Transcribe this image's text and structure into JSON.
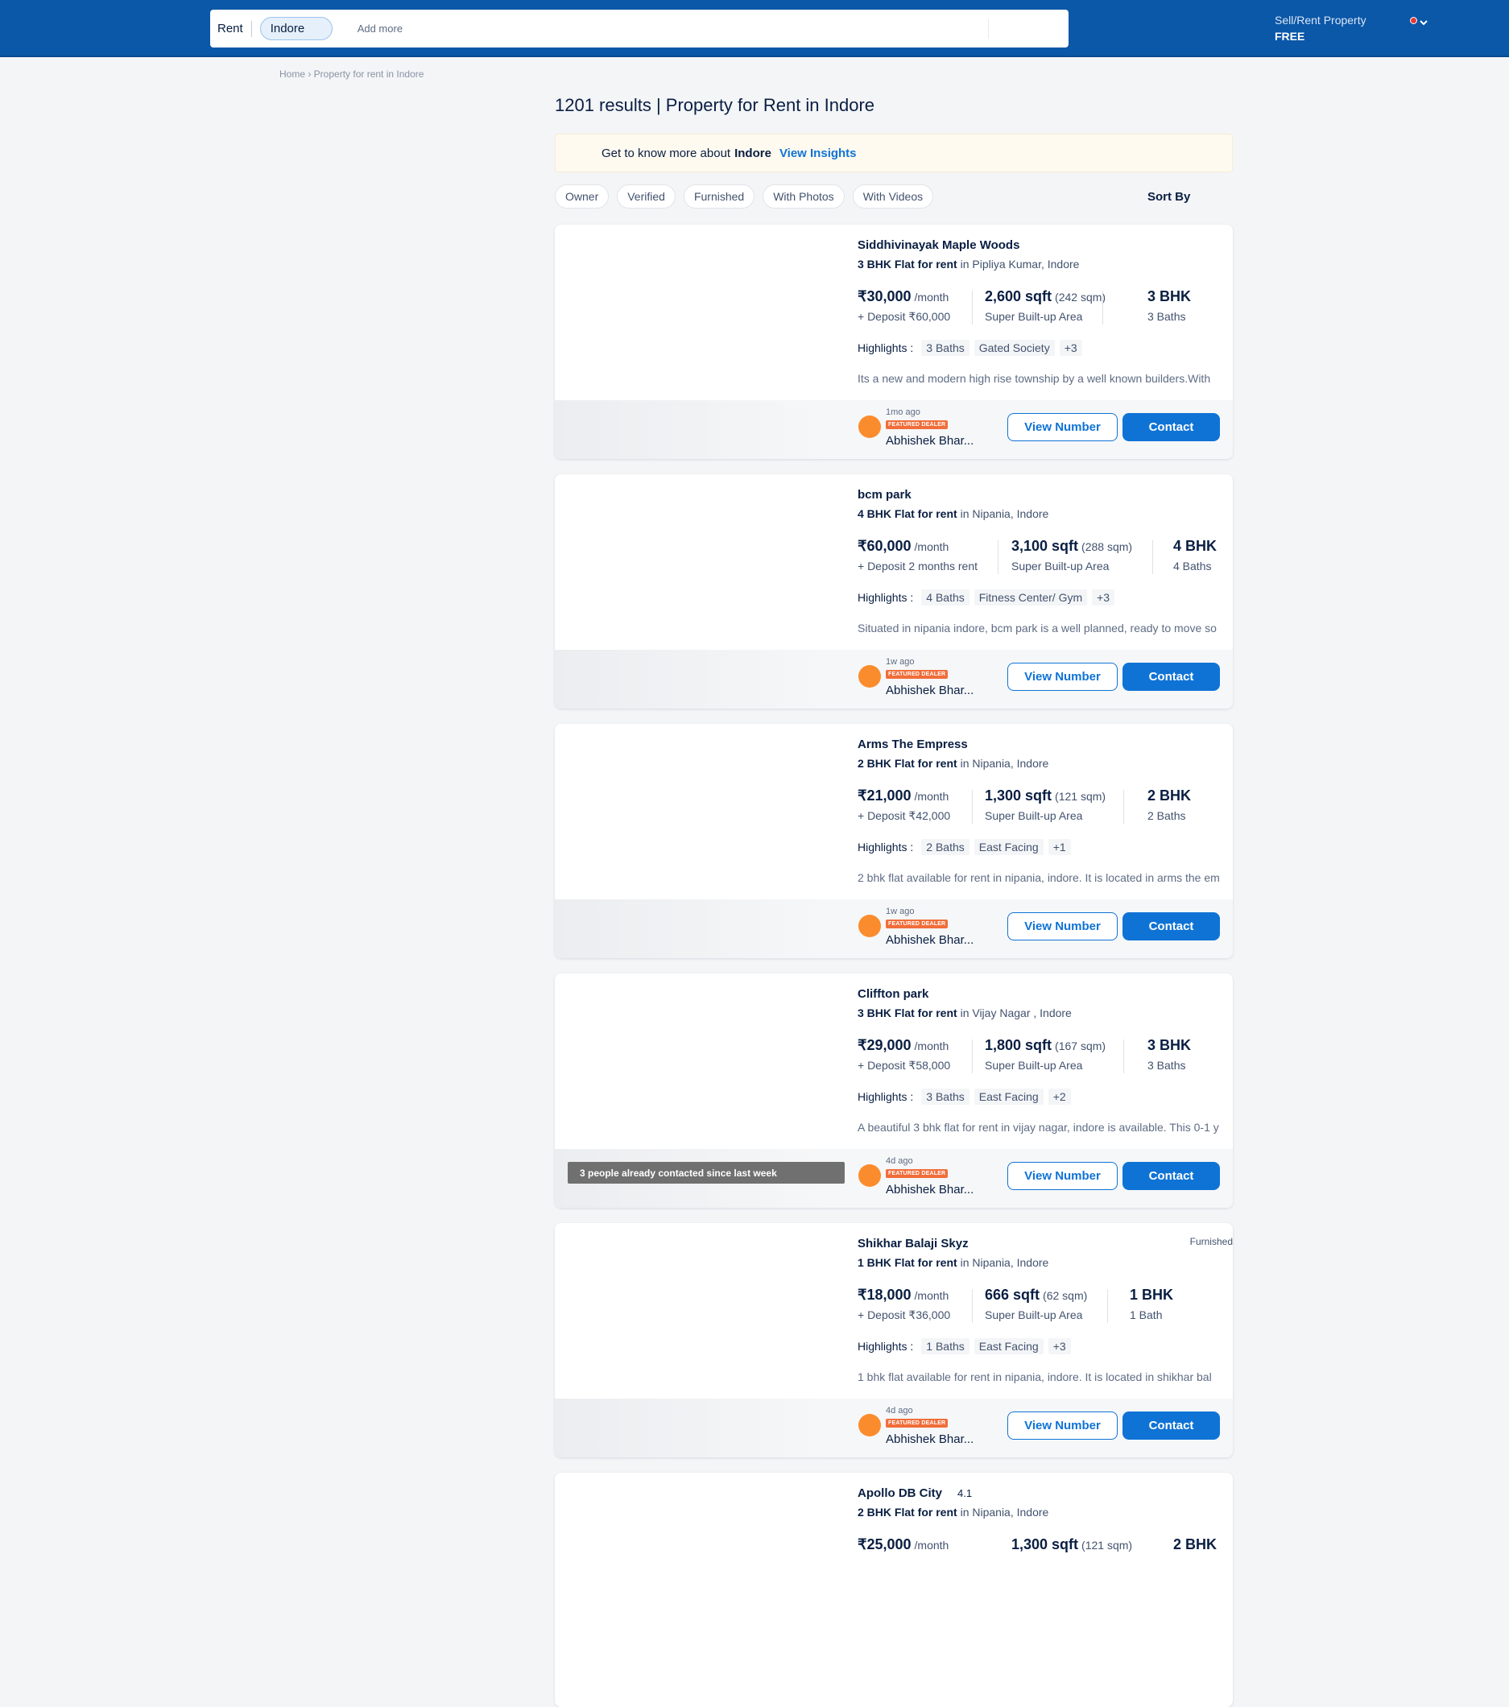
{
  "header": {
    "rent_label": "Rent",
    "city_chip": "Indore",
    "add_more": "Add more",
    "sell_rent": "Sell/Rent Property",
    "free": "FREE"
  },
  "breadcrumb": "Home › Property for rent in Indore",
  "title": "1201 results | Property for Rent in Indore",
  "insights": {
    "prefix": "Get to know more about",
    "city": "Indore",
    "link": "View Insights"
  },
  "filters": [
    "Owner",
    "Verified",
    "Furnished",
    "With Photos",
    "With Videos"
  ],
  "sort_by": "Sort By",
  "highlights_label": "Highlights :",
  "view_number": "View Number",
  "contact": "Contact",
  "featured_badge": "FEATURED DEALER",
  "listings": [
    {
      "name": "Siddhivinayak Maple Woods",
      "type": "3 BHK Flat for rent",
      "location": "in Pipliya Kumar, Indore",
      "price": "₹30,000",
      "per": "/month",
      "deposit": "+ Deposit ₹60,000",
      "area": "2,600 sqft",
      "sqm": "(242 sqm)",
      "area_type": "Super Built-up Area",
      "bhk": "3 BHK",
      "baths": "3 Baths",
      "highlights": [
        "3 Baths",
        "Gated Society",
        "+3"
      ],
      "description": "Its a new and modern high rise township by a well known builders.With",
      "ago": "1mo ago",
      "dealer": "Abhishek Bhar..."
    },
    {
      "name": "bcm park",
      "type": "4 BHK Flat for rent",
      "location": "in Nipania, Indore",
      "price": "₹60,000",
      "per": "/month",
      "deposit": "+ Deposit 2 months rent",
      "area": "3,100 sqft",
      "sqm": "(288 sqm)",
      "area_type": "Super Built-up Area",
      "bhk": "4 BHK",
      "baths": "4 Baths",
      "highlights": [
        "4 Baths",
        "Fitness Center/ Gym",
        "+3"
      ],
      "description": "Situated in nipania indore, bcm park is a well planned, ready to move so",
      "ago": "1w ago",
      "dealer": "Abhishek Bhar..."
    },
    {
      "name": "Arms The Empress",
      "type": "2 BHK Flat for rent",
      "location": "in Nipania, Indore",
      "price": "₹21,000",
      "per": "/month",
      "deposit": "+ Deposit ₹42,000",
      "area": "1,300 sqft",
      "sqm": "(121 sqm)",
      "area_type": "Super Built-up Area",
      "bhk": "2 BHK",
      "baths": "2 Baths",
      "highlights": [
        "2 Baths",
        "East Facing",
        "+1"
      ],
      "description": "2 bhk flat available for rent in nipania, indore. It is located in arms the em",
      "ago": "1w ago",
      "dealer": "Abhishek Bhar..."
    },
    {
      "name": "Cliffton park",
      "type": "3 BHK Flat for rent",
      "location": "in Vijay Nagar , Indore",
      "price": "₹29,000",
      "per": "/month",
      "deposit": "+ Deposit ₹58,000",
      "area": "1,800 sqft",
      "sqm": "(167 sqm)",
      "area_type": "Super Built-up Area",
      "bhk": "3 BHK",
      "baths": "3 Baths",
      "highlights": [
        "3 Baths",
        "East Facing",
        "+2"
      ],
      "description": "A beautiful 3 bhk flat for rent in vijay nagar, indore is available. This 0-1 y",
      "ago": "4d ago",
      "dealer": "Abhishek Bhar...",
      "contacted": "3 people already contacted since last week"
    },
    {
      "name": "Shikhar Balaji Skyz",
      "furnished": "Furnished",
      "type": "1 BHK Flat for rent",
      "location": "in Nipania, Indore",
      "price": "₹18,000",
      "per": "/month",
      "deposit": "+ Deposit ₹36,000",
      "area": "666 sqft",
      "sqm": "(62 sqm)",
      "area_type": "Super Built-up Area",
      "bhk": "1 BHK",
      "baths": "1 Bath",
      "highlights": [
        "1 Baths",
        "East Facing",
        "+3"
      ],
      "description": "1 bhk flat available for rent in nipania, indore. It is located in shikhar bal",
      "ago": "4d ago",
      "dealer": "Abhishek Bhar..."
    },
    {
      "name": "Apollo DB City",
      "rating": "4.1",
      "type": "2 BHK Flat for rent",
      "location": "in Nipania, Indore",
      "price": "₹25,000",
      "per": "/month",
      "area": "1,300 sqft",
      "sqm": "(121 sqm)",
      "bhk": "2 BHK"
    }
  ]
}
